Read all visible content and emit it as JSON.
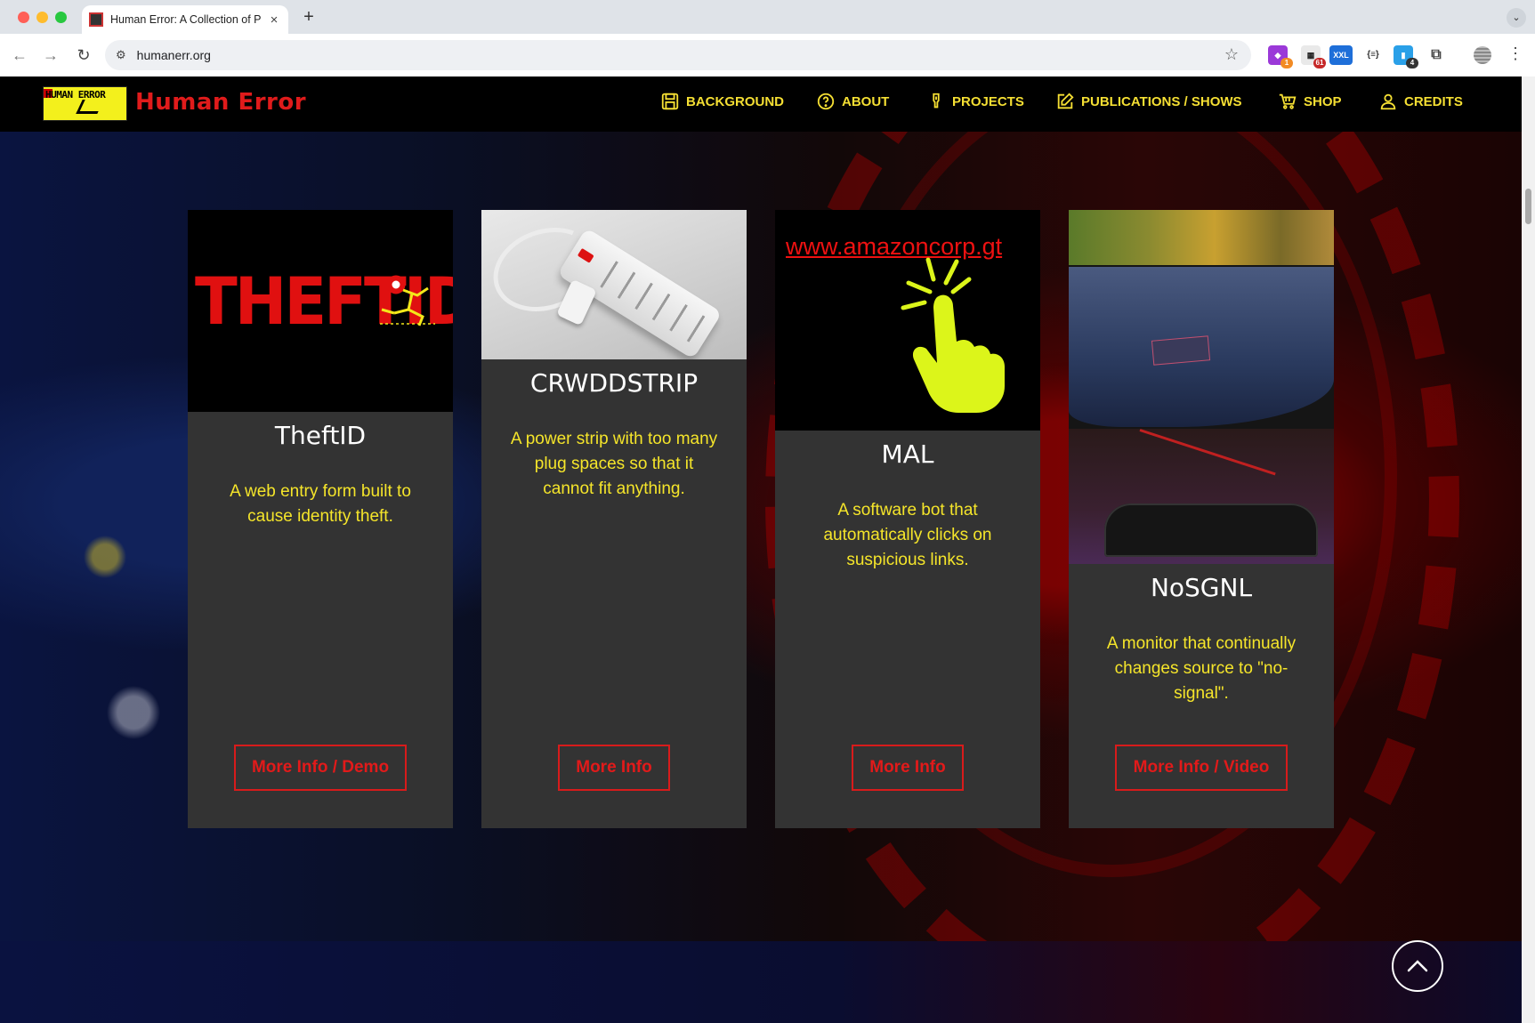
{
  "browser": {
    "tab_title": "Human Error: A Collection of Projects",
    "tab_close": "×",
    "new_tab": "+",
    "tab_menu": "⌄",
    "url": "humanerr.org",
    "extensions": [
      {
        "icon": "puzzle-purple-icon",
        "badge": "1"
      },
      {
        "icon": "calendar-icon",
        "badge": "61"
      },
      {
        "icon": "xxl-icon",
        "label": "XXL"
      },
      {
        "icon": "json-icon",
        "label": "{≡}"
      },
      {
        "icon": "bookmark-icon",
        "badge": "4"
      },
      {
        "icon": "extensions-icon"
      }
    ]
  },
  "header": {
    "logo_text": "HUMAN ERROR",
    "brand": "Human Error",
    "nav": [
      {
        "label": "BACKGROUND",
        "icon": "save-icon"
      },
      {
        "label": "ABOUT",
        "icon": "question-icon"
      },
      {
        "label": "PROJECTS",
        "icon": "bulb-icon"
      },
      {
        "label": "PUBLICATIONS / SHOWS",
        "icon": "edit-icon"
      },
      {
        "label": "SHOP",
        "icon": "cart-icon"
      },
      {
        "label": "CREDITS",
        "icon": "user-icon"
      }
    ],
    "text_color": "#f5df33",
    "brand_color": "#e01b1b"
  },
  "cards": [
    {
      "image_text": "THEFTID",
      "title": "TheftID",
      "description": "A web entry form built to cause identity theft.",
      "button": "More Info / Demo"
    },
    {
      "title": "CRWDDSTRIP",
      "description": "A power strip with too many plug spaces so that it cannot fit anything.",
      "button": "More Info"
    },
    {
      "image_text": "www.amazoncorp.gt",
      "title": "MAL",
      "description": "A software bot that automatically clicks on suspicious links.",
      "button": "More Info"
    },
    {
      "title": "NoSGNL",
      "description": "A monitor that continually changes source to \"no-signal\".",
      "button": "More Info / Video"
    }
  ],
  "colors": {
    "card_bg": "#333333",
    "accent_yellow": "#f5e52a",
    "button_red": "#d81b1b"
  }
}
